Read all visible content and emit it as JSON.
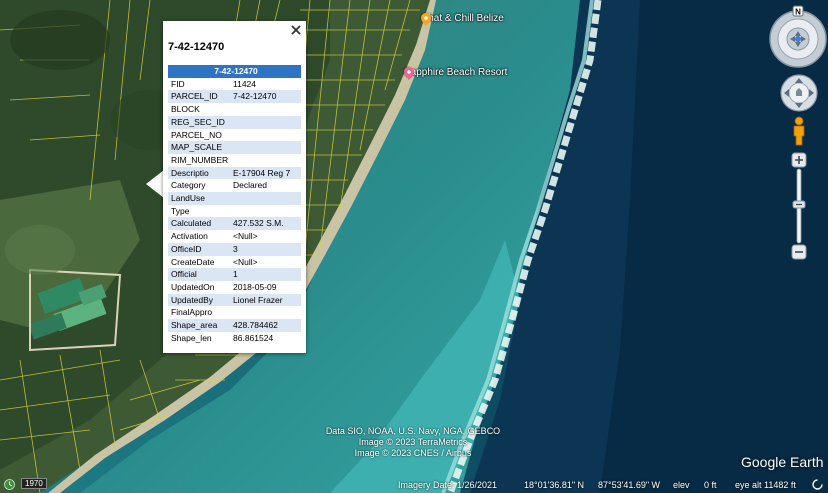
{
  "map": {
    "pois": [
      {
        "label": "Chat & Chill Belize",
        "icon": "orange-pin-icon",
        "color": "#f5a623"
      },
      {
        "label": "Sapphire Beach Resort",
        "icon": "pink-pin-icon",
        "color": "#f06292"
      }
    ]
  },
  "balloon": {
    "title": "7-42-12470",
    "header": "7-42-12470",
    "rows": [
      {
        "key": "FID",
        "value": "11424"
      },
      {
        "key": "PARCEL_ID",
        "value": "7-42-12470"
      },
      {
        "key": "BLOCK",
        "value": ""
      },
      {
        "key": "REG_SEC_ID",
        "value": ""
      },
      {
        "key": "PARCEL_NO",
        "value": ""
      },
      {
        "key": "MAP_SCALE",
        "value": ""
      },
      {
        "key": "RIM_NUMBER",
        "value": ""
      },
      {
        "key": "Descriptio",
        "value": "E-17904 Reg 7"
      },
      {
        "key": "Category",
        "value": "Declared"
      },
      {
        "key": "LandUse",
        "value": ""
      },
      {
        "key": "Type",
        "value": ""
      },
      {
        "key": "Calculated",
        "value": "427.532 S.M."
      },
      {
        "key": "Activation",
        "value": "<Null>"
      },
      {
        "key": "OfficeID",
        "value": "3"
      },
      {
        "key": "CreateDate",
        "value": "<Null>"
      },
      {
        "key": "Official",
        "value": "1"
      },
      {
        "key": "UpdatedOn",
        "value": "2018-05-09"
      },
      {
        "key": "UpdatedBy",
        "value": "Lionel Frazer"
      },
      {
        "key": "FinalAppro",
        "value": ""
      },
      {
        "key": "Shape_area",
        "value": "428.784462"
      },
      {
        "key": "Shape_len",
        "value": "86.861524"
      }
    ],
    "header_color": "#2f73c5",
    "stripe_color": "#dbe6f4"
  },
  "controls": {
    "compass_north": "N"
  },
  "attribution": {
    "line1": "Data SIO, NOAA, U.S. Navy, NGA, GEBCO",
    "line2": "Image © 2023 TerraMetrics",
    "line3": "Image © 2023 CNES / Airbus"
  },
  "logo": "Google Earth",
  "status": {
    "year": "1970",
    "imagery_date": "Imagery Date: 1/26/2021",
    "lat": "18°01'36.81\" N",
    "lon": "87°53'41.69\" W",
    "elev_label": "elev",
    "elev_value": "0 ft",
    "eye_alt": "eye alt  11482 ft"
  }
}
